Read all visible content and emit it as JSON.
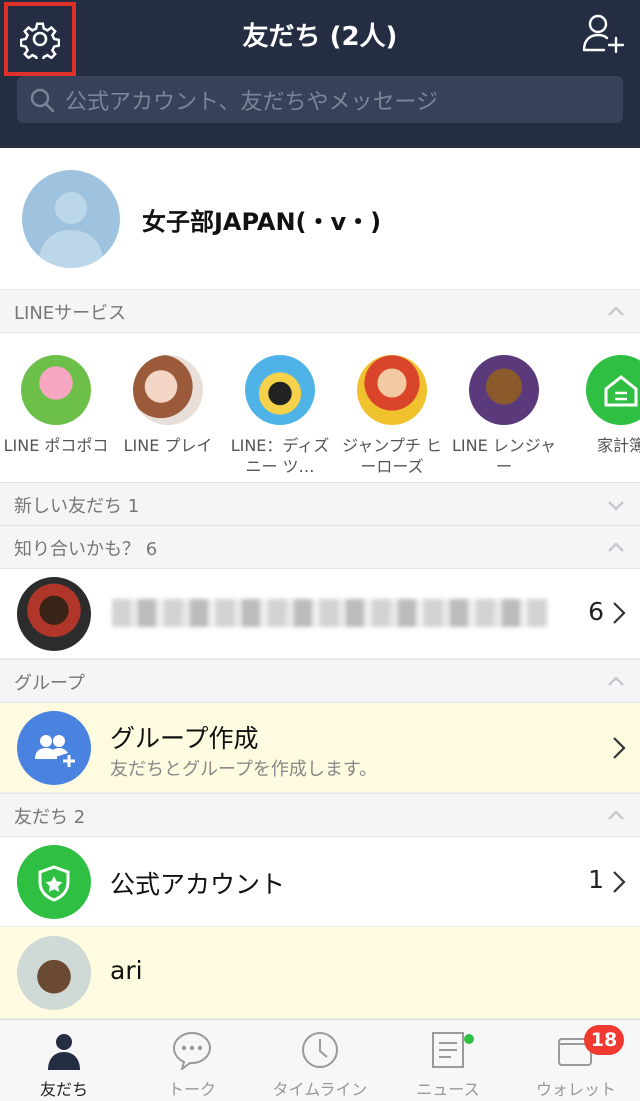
{
  "header": {
    "title": "友だち (2人)",
    "search_placeholder": "公式アカウント、友だちやメッセージ"
  },
  "profile": {
    "name": "女子部JAPAN(・v・)"
  },
  "sections": {
    "line_services": "LINEサービス",
    "new_friends": "新しい友だち 1",
    "maybe_know": "知り合いかも？ 6",
    "groups": "グループ",
    "friends": "友だち 2"
  },
  "services": [
    {
      "label": "LINE ポコポコ",
      "icon": "pokopoko-icon"
    },
    {
      "label": "LINE プレイ",
      "icon": "line-play-icon"
    },
    {
      "label": "LINE：ディズニー ツ…",
      "icon": "disney-tsumtsum-icon"
    },
    {
      "label": "ジャンプチ ヒーローズ",
      "icon": "jumputi-heroes-icon"
    },
    {
      "label": "LINE レンジャー",
      "icon": "line-rangers-icon"
    },
    {
      "label": "家計簿",
      "icon": "household-book-icon"
    }
  ],
  "maybe_know_row": {
    "count": "6"
  },
  "group_row": {
    "title": "グループ作成",
    "subtitle": "友だちとグループを作成します。"
  },
  "official_row": {
    "title": "公式アカウント",
    "count": "1"
  },
  "friend_row": {
    "name": "ari"
  },
  "tabs": [
    {
      "label": "友だち",
      "icon": "person-icon",
      "active": true
    },
    {
      "label": "トーク",
      "icon": "chat-bubble-icon"
    },
    {
      "label": "タイムライン",
      "icon": "clock-icon"
    },
    {
      "label": "ニュース",
      "icon": "news-icon"
    },
    {
      "label": "ウォレット",
      "icon": "wallet-icon",
      "badge": "18"
    }
  ],
  "colors": {
    "header_bg": "#252d43",
    "accent_green": "#2fc043",
    "badge_red": "#f0392f"
  }
}
